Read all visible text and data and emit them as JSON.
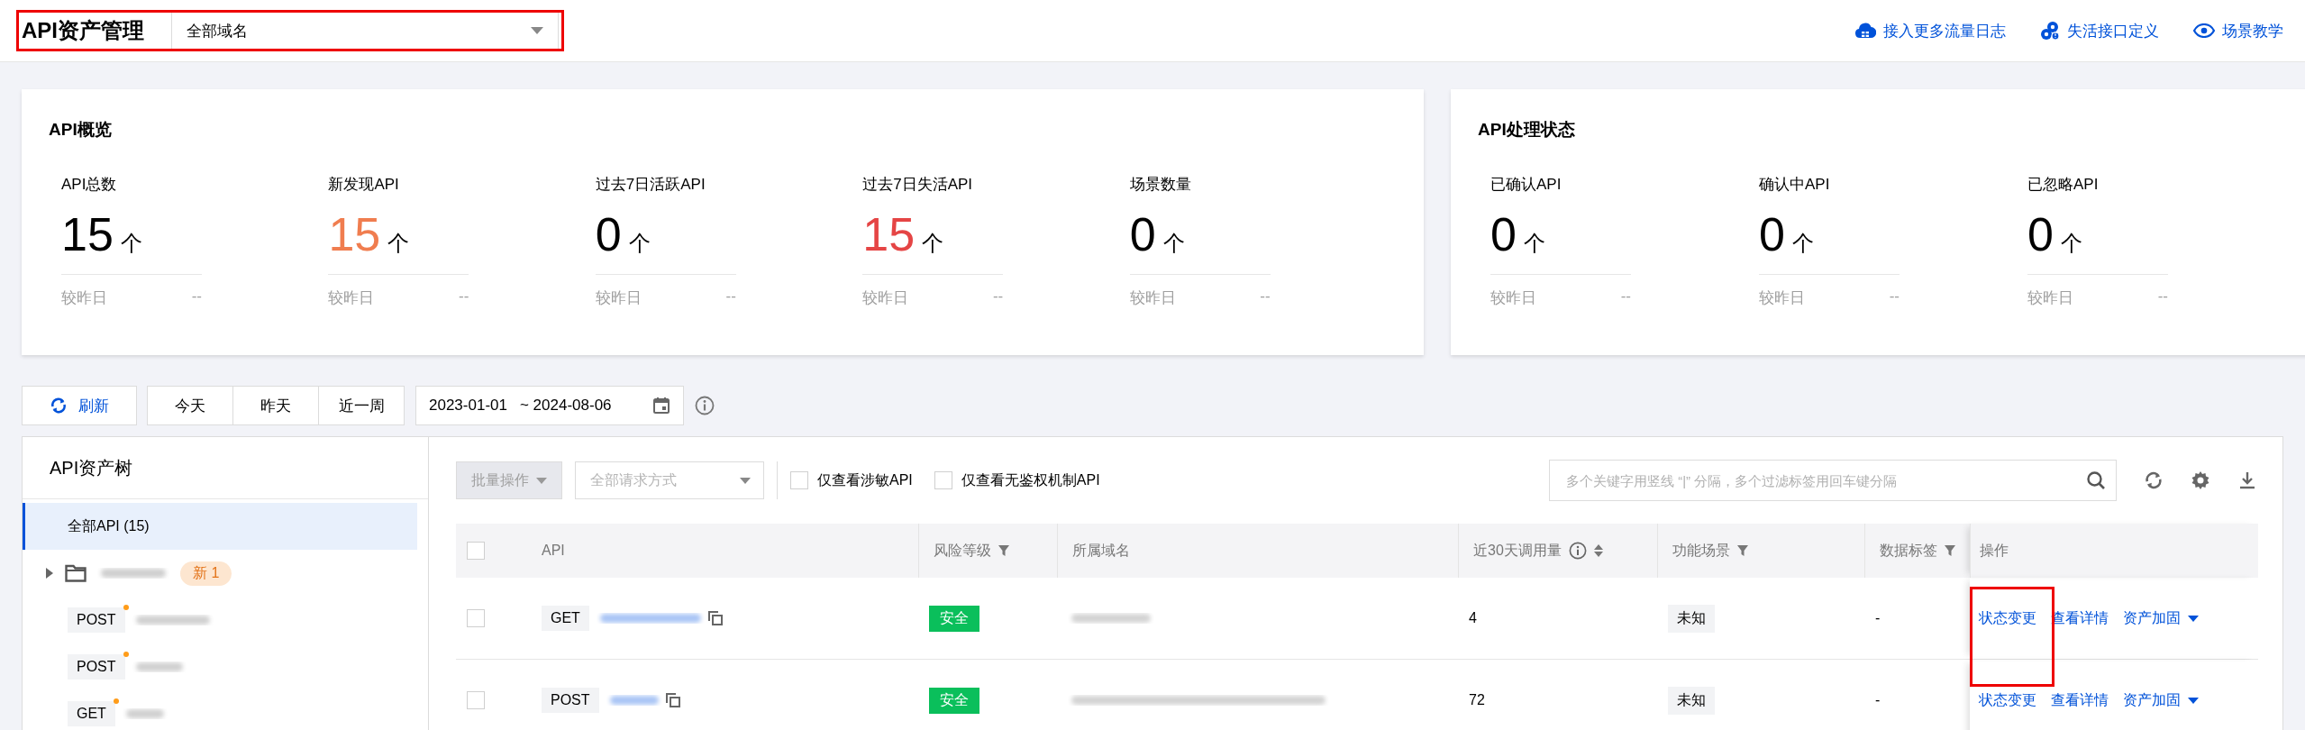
{
  "header": {
    "title": "API资产管理",
    "domain_select": {
      "value": "全部域名"
    },
    "links": [
      {
        "label": "接入更多流量日志"
      },
      {
        "label": "失活接口定义"
      },
      {
        "label": "场景教学"
      }
    ]
  },
  "overview": {
    "title": "API概览",
    "stats": [
      {
        "label": "API总数",
        "value": "15",
        "unit": "个",
        "color": "#000000",
        "compare_label": "较昨日",
        "compare_value": "--"
      },
      {
        "label": "新发现API",
        "value": "15",
        "unit": "个",
        "color": "#f07d4f",
        "compare_label": "较昨日",
        "compare_value": "--"
      },
      {
        "label": "过去7日活跃API",
        "value": "0",
        "unit": "个",
        "color": "#000000",
        "compare_label": "较昨日",
        "compare_value": "--"
      },
      {
        "label": "过去7日失活API",
        "value": "15",
        "unit": "个",
        "color": "#e54545",
        "compare_label": "较昨日",
        "compare_value": "--"
      },
      {
        "label": "场景数量",
        "value": "0",
        "unit": "个",
        "color": "#000000",
        "compare_label": "较昨日",
        "compare_value": "--"
      }
    ]
  },
  "status": {
    "title": "API处理状态",
    "stats": [
      {
        "label": "已确认API",
        "value": "0",
        "unit": "个",
        "color": "#000000",
        "compare_label": "较昨日",
        "compare_value": "--"
      },
      {
        "label": "确认中API",
        "value": "0",
        "unit": "个",
        "color": "#000000",
        "compare_label": "较昨日",
        "compare_value": "--"
      },
      {
        "label": "已忽略API",
        "value": "0",
        "unit": "个",
        "color": "#000000",
        "compare_label": "较昨日",
        "compare_value": "--"
      }
    ]
  },
  "toolbar": {
    "refresh": "刷新",
    "ranges": [
      {
        "label": "今天",
        "selected": false
      },
      {
        "label": "昨天",
        "selected": false
      },
      {
        "label": "近一周",
        "selected": false
      }
    ],
    "date_start": "2023-01-01",
    "date_end": "~ 2024-08-06"
  },
  "tree": {
    "title": "API资产树",
    "items": [
      {
        "kind": "all",
        "label": "全部API (15)",
        "selected": true
      },
      {
        "kind": "folder",
        "badge": "新 1",
        "expanded": false,
        "selected": false
      },
      {
        "kind": "api",
        "method": "POST",
        "new": true,
        "selected": false
      },
      {
        "kind": "api",
        "method": "POST",
        "new": true,
        "selected": false
      },
      {
        "kind": "api",
        "method": "GET",
        "new": true,
        "selected": false
      }
    ]
  },
  "table": {
    "bulk_action": {
      "label": "批量操作",
      "disabled": true
    },
    "method_filter": {
      "placeholder": "全部请求方式"
    },
    "filters": [
      {
        "label": "仅查看涉敏API",
        "checked": false
      },
      {
        "label": "仅查看无鉴权机制API",
        "checked": false
      }
    ],
    "select_all_checked": false,
    "search": {
      "placeholder": "多个关键字用竖线 “|” 分隔，多个过滤标签用回车键分隔"
    },
    "columns": [
      {
        "label": "API",
        "kind": "plain"
      },
      {
        "label": "风险等级",
        "kind": "filter"
      },
      {
        "label": "所属域名",
        "kind": "plain"
      },
      {
        "label": "近30天调用量",
        "kind": "sort"
      },
      {
        "label": "功能场景",
        "kind": "filter"
      },
      {
        "label": "数据标签",
        "kind": "filter"
      },
      {
        "label": "操作",
        "kind": "plain"
      }
    ],
    "rows": [
      {
        "checked": false,
        "method": "GET",
        "risk": "安全",
        "calls": "4",
        "scene": "未知",
        "tag": "-",
        "actions": [
          "状态变更",
          "查看详情",
          "资产加固"
        ]
      },
      {
        "checked": false,
        "method": "POST",
        "risk": "安全",
        "calls": "72",
        "scene": "未知",
        "tag": "-",
        "actions": [
          "状态变更",
          "查看详情",
          "资产加固"
        ]
      }
    ]
  }
}
